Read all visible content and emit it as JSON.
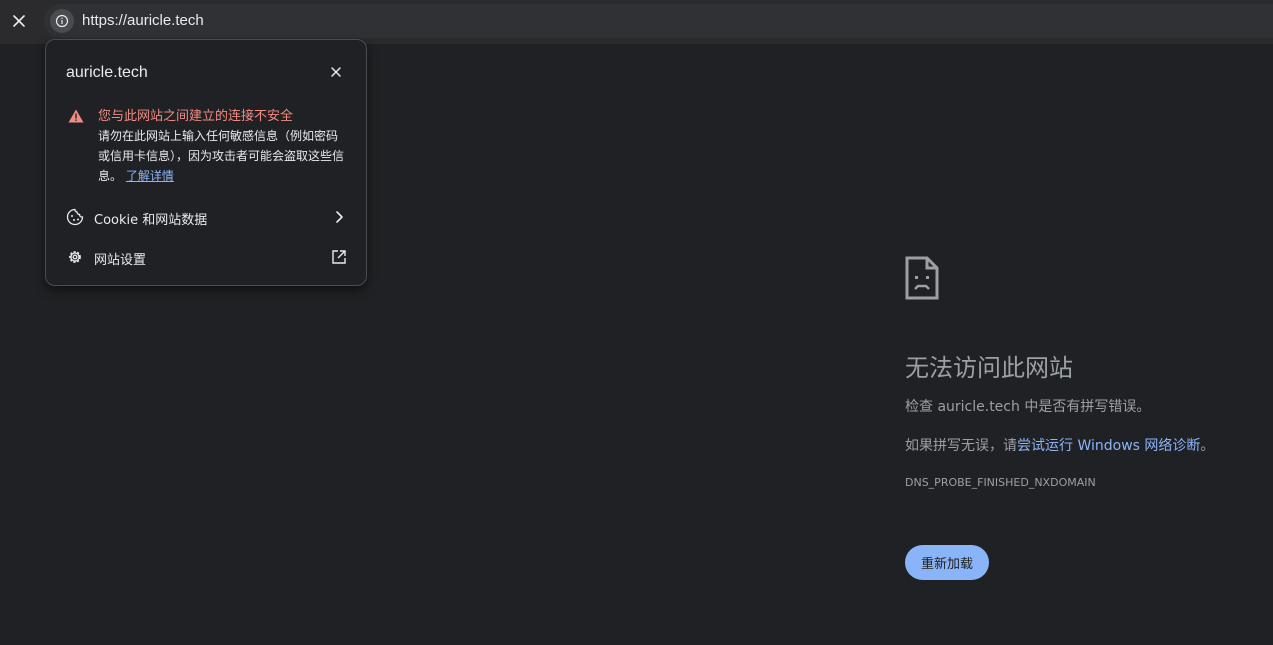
{
  "toolbar": {
    "url": "https://auricle.tech"
  },
  "popup": {
    "title": "auricle.tech",
    "warning_title": "您与此网站之间建立的连接不安全",
    "warning_body": "请勿在此网站上输入任何敏感信息（例如密码或信用卡信息），因为攻击者可能会盗取这些信息。",
    "learn_more": "了解详情",
    "items": [
      {
        "label": "Cookie 和网站数据"
      },
      {
        "label": "网站设置"
      }
    ]
  },
  "error_page": {
    "heading": "无法访问此网站",
    "line1": "检查 auricle.tech 中是否有拼写错误。",
    "line2_prefix": "如果拼写无误，请",
    "line2_link": "尝试运行 Windows 网络诊断",
    "line2_suffix": "。",
    "error_code": "DNS_PROBE_FINISHED_NXDOMAIN",
    "reload_label": "重新加载"
  },
  "colors": {
    "background": "#202124",
    "accent": "#8ab4f8",
    "warning": "#f28b82"
  }
}
